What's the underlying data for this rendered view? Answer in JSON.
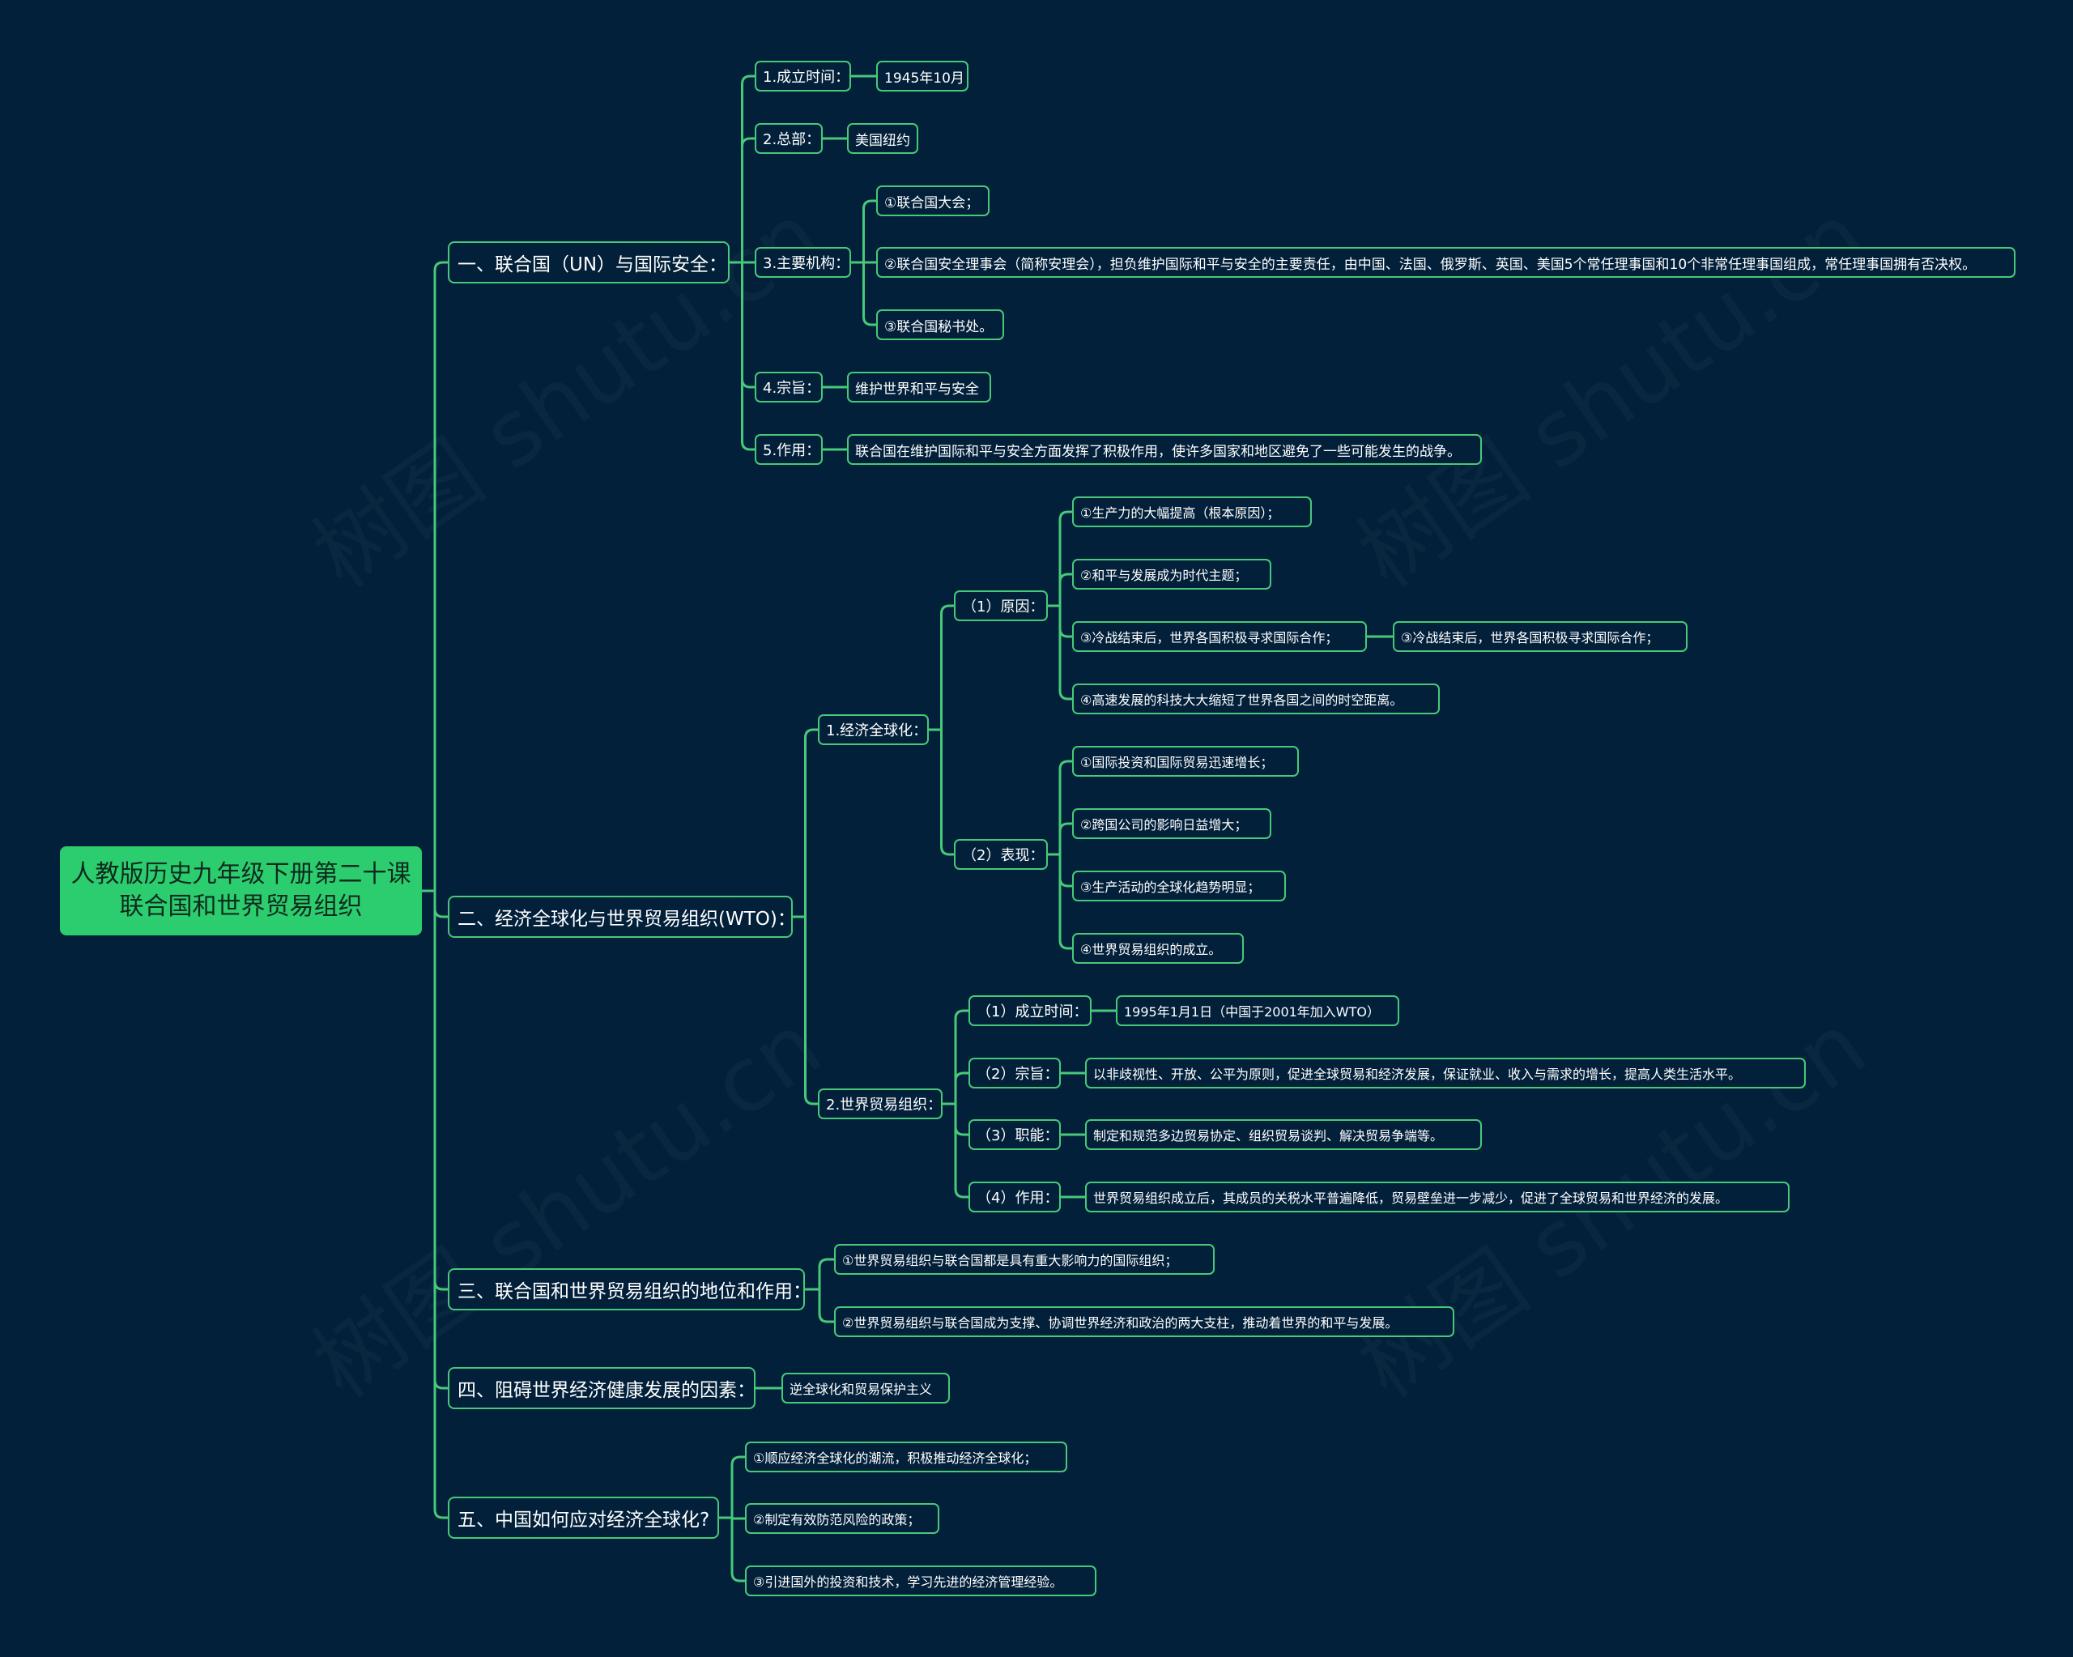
{
  "colors": {
    "background": "#02203a",
    "accent": "#2bcd6f",
    "line": "#47c979"
  },
  "root": {
    "line1": "人教版历史九年级下册第二十课",
    "line2": "联合国和世界贸易组织"
  },
  "b1": {
    "label": "一、联合国（UN）与国际安全：",
    "c1": {
      "label": "1.成立时间：",
      "v": "1945年10月"
    },
    "c2": {
      "label": "2.总部：",
      "v": "美国纽约"
    },
    "c3": {
      "label": "3.主要机构：",
      "v1": "①联合国大会；",
      "v2": "②联合国安全理事会（简称安理会），担负维护国际和平与安全的主要责任，由中国、法国、俄罗斯、英国、美国5个常任理事国和10个非常任理事国组成，常任理事国拥有否决权。",
      "v3": "③联合国秘书处。"
    },
    "c4": {
      "label": "4.宗旨：",
      "v": "维护世界和平与安全"
    },
    "c5": {
      "label": "5.作用：",
      "v": "联合国在维护国际和平与安全方面发挥了积极作用，使许多国家和地区避免了一些可能发生的战争。"
    }
  },
  "b2": {
    "label": "二、经济全球化与世界贸易组织(WTO)：",
    "g1": {
      "label": "1.经济全球化：",
      "r": {
        "label": "（1）原因：",
        "i1": "①生产力的大幅提高（根本原因）；",
        "i2": "②和平与发展成为时代主题；",
        "i3": "③冷战结束后，世界各国积极寻求国际合作；",
        "i3a": "③冷战结束后，世界各国积极寻求国际合作；",
        "i4": "④高速发展的科技大大缩短了世界各国之间的时空距离。"
      },
      "p": {
        "label": "（2）表现：",
        "i1": "①国际投资和国际贸易迅速增长；",
        "i2": "②跨国公司的影响日益增大；",
        "i3": "③生产活动的全球化趋势明显；",
        "i4": "④世界贸易组织的成立。"
      }
    },
    "g2": {
      "label": "2.世界贸易组织：",
      "w1": {
        "label": "（1）成立时间：",
        "v": "1995年1月1日（中国于2001年加入WTO）"
      },
      "w2": {
        "label": "（2）宗旨：",
        "v": "以非歧视性、开放、公平为原则，促进全球贸易和经济发展，保证就业、收入与需求的增长，提高人类生活水平。"
      },
      "w3": {
        "label": "（3）职能：",
        "v": "制定和规范多边贸易协定、组织贸易谈判、解决贸易争端等。"
      },
      "w4": {
        "label": "（4）作用：",
        "v": "世界贸易组织成立后，其成员的关税水平普遍降低，贸易壁垒进一步减少，促进了全球贸易和世界经济的发展。"
      }
    }
  },
  "b3": {
    "label": "三、联合国和世界贸易组织的地位和作用：",
    "i1": "①世界贸易组织与联合国都是具有重大影响力的国际组织；",
    "i2": "②世界贸易组织与联合国成为支撑、协调世界经济和政治的两大支柱，推动着世界的和平与发展。"
  },
  "b4": {
    "label": "四、阻碍世界经济健康发展的因素：",
    "i1": "逆全球化和贸易保护主义"
  },
  "b5": {
    "label": "五、中国如何应对经济全球化?",
    "i1": "①顺应经济全球化的潮流，积极推动经济全球化；",
    "i2": "②制定有效防范风险的政策；",
    "i3": "③引进国外的投资和技术，学习先进的经济管理经验。"
  },
  "watermark": "树图 shutu.cn"
}
